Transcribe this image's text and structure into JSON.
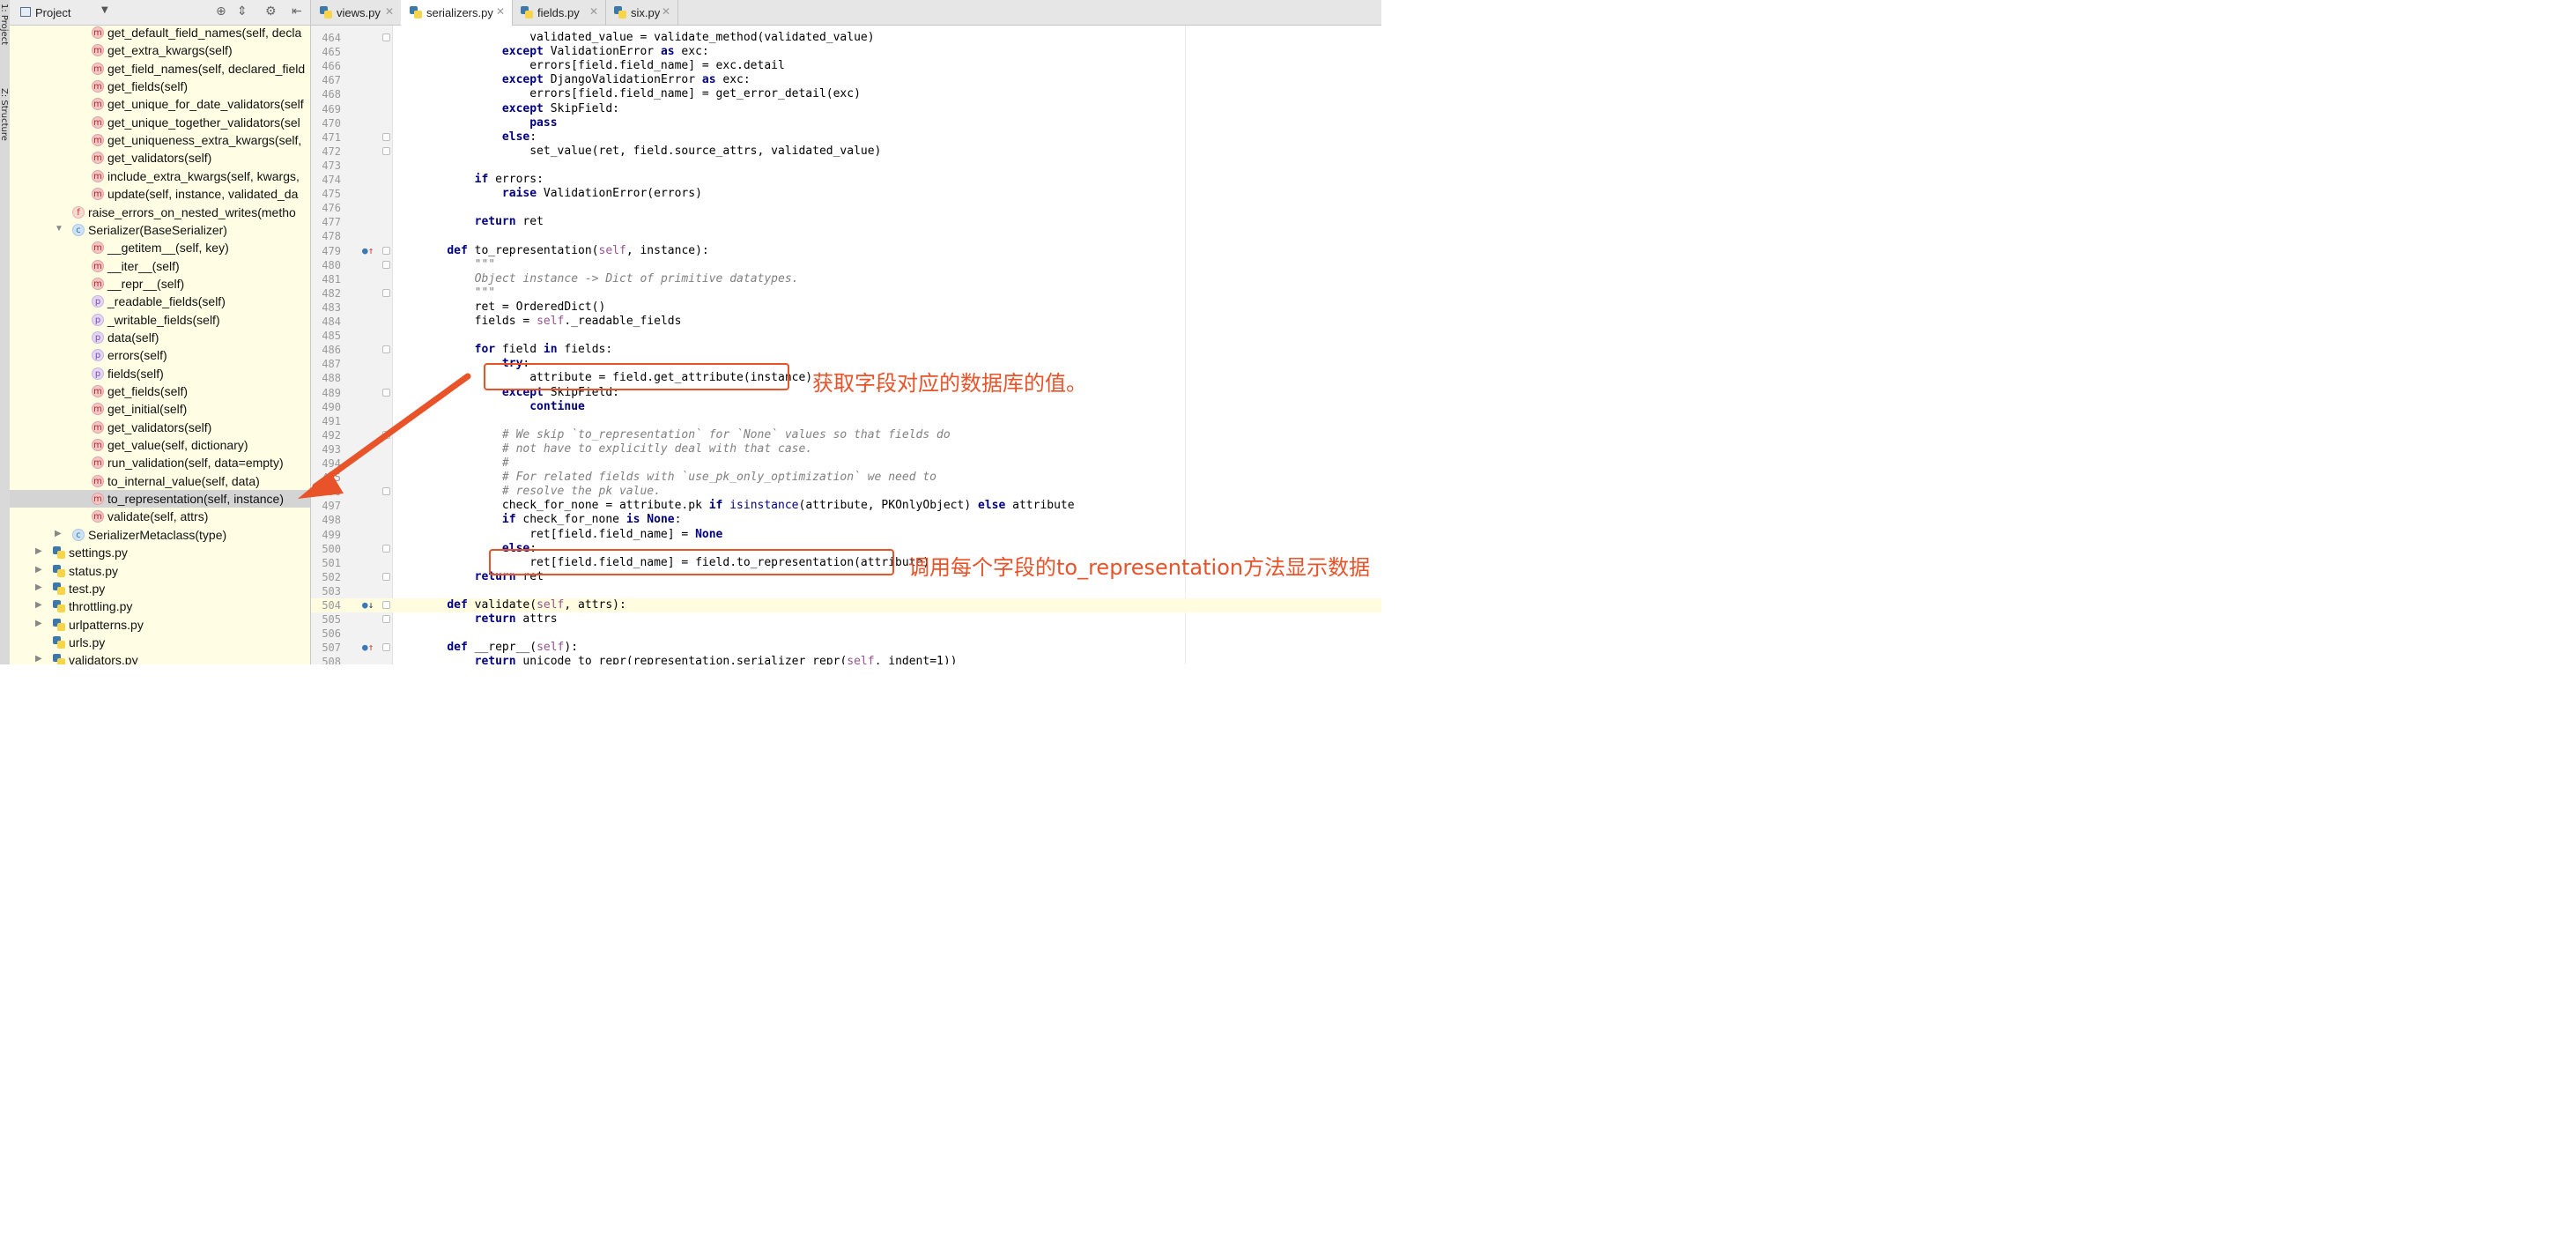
{
  "tool_strip": {
    "project_label": "1: Project",
    "structure_label": "Z: Structure"
  },
  "project_panel": {
    "title": "Project",
    "tree": [
      {
        "kind": "m",
        "label": "get_default_field_names(self, decla",
        "indent": 104
      },
      {
        "kind": "m",
        "label": "get_extra_kwargs(self)",
        "indent": 104
      },
      {
        "kind": "m",
        "label": "get_field_names(self, declared_field",
        "indent": 104
      },
      {
        "kind": "m",
        "label": "get_fields(self)",
        "indent": 104
      },
      {
        "kind": "m",
        "label": "get_unique_for_date_validators(self",
        "indent": 104
      },
      {
        "kind": "m",
        "label": "get_unique_together_validators(sel",
        "indent": 104
      },
      {
        "kind": "m",
        "label": "get_uniqueness_extra_kwargs(self,",
        "indent": 104
      },
      {
        "kind": "m",
        "label": "get_validators(self)",
        "indent": 104
      },
      {
        "kind": "m",
        "label": "include_extra_kwargs(self, kwargs,",
        "indent": 104
      },
      {
        "kind": "m",
        "label": "update(self, instance, validated_da",
        "indent": 104
      },
      {
        "kind": "f",
        "label": "raise_errors_on_nested_writes(metho",
        "indent": 82
      },
      {
        "kind": "c",
        "label": "Serializer(BaseSerializer)",
        "indent": 82,
        "arrow": "▼"
      },
      {
        "kind": "m",
        "label": "__getitem__(self, key)",
        "indent": 104
      },
      {
        "kind": "m",
        "label": "__iter__(self)",
        "indent": 104
      },
      {
        "kind": "m",
        "label": "__repr__(self)",
        "indent": 104
      },
      {
        "kind": "p",
        "label": "_readable_fields(self)",
        "indent": 104
      },
      {
        "kind": "p",
        "label": "_writable_fields(self)",
        "indent": 104
      },
      {
        "kind": "p",
        "label": "data(self)",
        "indent": 104
      },
      {
        "kind": "p",
        "label": "errors(self)",
        "indent": 104
      },
      {
        "kind": "p",
        "label": "fields(self)",
        "indent": 104
      },
      {
        "kind": "m",
        "label": "get_fields(self)",
        "indent": 104
      },
      {
        "kind": "m",
        "label": "get_initial(self)",
        "indent": 104
      },
      {
        "kind": "m",
        "label": "get_validators(self)",
        "indent": 104
      },
      {
        "kind": "m",
        "label": "get_value(self, dictionary)",
        "indent": 104
      },
      {
        "kind": "m",
        "label": "run_validation(self, data=empty)",
        "indent": 104
      },
      {
        "kind": "m",
        "label": "to_internal_value(self, data)",
        "indent": 104
      },
      {
        "kind": "m",
        "label": "to_representation(self, instance)",
        "indent": 104,
        "selected": true
      },
      {
        "kind": "m",
        "label": "validate(self, attrs)",
        "indent": 104
      },
      {
        "kind": "c",
        "label": "SerializerMetaclass(type)",
        "indent": 82,
        "arrow": "▶"
      },
      {
        "kind": "py",
        "label": "settings.py",
        "indent": 60,
        "arrow": "▶"
      },
      {
        "kind": "py",
        "label": "status.py",
        "indent": 60,
        "arrow": "▶"
      },
      {
        "kind": "py",
        "label": "test.py",
        "indent": 60,
        "arrow": "▶"
      },
      {
        "kind": "py",
        "label": "throttling.py",
        "indent": 60,
        "arrow": "▶"
      },
      {
        "kind": "py",
        "label": "urlpatterns.py",
        "indent": 60,
        "arrow": "▶"
      },
      {
        "kind": "py",
        "label": "urls.py",
        "indent": 60
      },
      {
        "kind": "py",
        "label": "validators.py",
        "indent": 60,
        "arrow": "▶"
      }
    ]
  },
  "tabs": [
    {
      "label": "views.py",
      "active": false
    },
    {
      "label": "serializers.py",
      "active": true
    },
    {
      "label": "fields.py",
      "active": false
    },
    {
      "label": "six.py",
      "active": false
    }
  ],
  "editor": {
    "lines": [
      {
        "n": "464",
        "html": "                <span>validated_value = validate_method(validated_value)</span>"
      },
      {
        "n": "465",
        "html": "            <span class=\"kw\">except</span> ValidationError <span class=\"kw\">as</span> exc:"
      },
      {
        "n": "466",
        "html": "                errors[field.field_name] = exc.detail"
      },
      {
        "n": "467",
        "html": "            <span class=\"kw\">except</span> DjangoValidationError <span class=\"kw\">as</span> exc:"
      },
      {
        "n": "468",
        "html": "                errors[field.field_name] = get_error_detail(exc)"
      },
      {
        "n": "469",
        "html": "            <span class=\"kw\">except</span> SkipField:"
      },
      {
        "n": "470",
        "html": "                <span class=\"kw\">pass</span>"
      },
      {
        "n": "471",
        "html": "            <span class=\"kw\">else</span>:"
      },
      {
        "n": "472",
        "html": "                set_value(ret, field.source_attrs, validated_value)"
      },
      {
        "n": "473",
        "html": ""
      },
      {
        "n": "474",
        "html": "        <span class=\"kw\">if</span> errors:"
      },
      {
        "n": "475",
        "html": "            <span class=\"kw\">raise</span> ValidationError(errors)"
      },
      {
        "n": "476",
        "html": ""
      },
      {
        "n": "477",
        "html": "        <span class=\"kw\">return</span> ret"
      },
      {
        "n": "478",
        "html": ""
      },
      {
        "n": "479",
        "html": "    <span class=\"kw\">def</span> to_representation(<span class=\"self\">self</span>, instance):"
      },
      {
        "n": "480",
        "html": "        <span class=\"cm\">\"\"\"</span>"
      },
      {
        "n": "481",
        "html": "        <span class=\"cm\">Object instance -&gt; Dict of primitive datatypes.</span>"
      },
      {
        "n": "482",
        "html": "        <span class=\"cm\">\"\"\"</span>"
      },
      {
        "n": "483",
        "html": "        ret = OrderedDict()"
      },
      {
        "n": "484",
        "html": "        fields = <span class=\"self\">self</span>._readable_fields"
      },
      {
        "n": "485",
        "html": ""
      },
      {
        "n": "486",
        "html": "        <span class=\"kw\">for</span> field <span class=\"kw\">in</span> fields:"
      },
      {
        "n": "487",
        "html": "            <span class=\"kw\">try</span>:"
      },
      {
        "n": "488",
        "html": "                attribute = field.get_attribute(instance)"
      },
      {
        "n": "489",
        "html": "            <span class=\"kw\">except</span> SkipField:"
      },
      {
        "n": "490",
        "html": "                <span class=\"kw\">continue</span>"
      },
      {
        "n": "491",
        "html": ""
      },
      {
        "n": "492",
        "html": "            <span class=\"cm\"># We skip `to_representation` for `None` values so that fields do</span>"
      },
      {
        "n": "493",
        "html": "            <span class=\"cm\"># not have to explicitly deal with that case.</span>"
      },
      {
        "n": "494",
        "html": "            <span class=\"cm\">#</span>"
      },
      {
        "n": "495",
        "html": "            <span class=\"cm\"># For related fields with `use_pk_only_optimization` we need to</span>"
      },
      {
        "n": "496",
        "html": "            <span class=\"cm\"># resolve the pk value.</span>"
      },
      {
        "n": "497",
        "html": "            check_for_none = attribute.pk <span class=\"kw\">if</span> <span style=\"color:#000080\">isinstance</span>(attribute, PKOnlyObject) <span class=\"kw\">else</span> attribute"
      },
      {
        "n": "498",
        "html": "            <span class=\"kw\">if</span> check_for_none <span class=\"kw\">is</span> <span class=\"kw\">None</span>:"
      },
      {
        "n": "499",
        "html": "                ret[field.field_name] = <span class=\"kw\">None</span>"
      },
      {
        "n": "500",
        "html": "            <span class=\"kw\">else</span>:"
      },
      {
        "n": "501",
        "html": "                ret[field.field_name] = field.to_representation(attribute)"
      },
      {
        "n": "502",
        "html": "        <span class=\"kw\">return</span> ret"
      },
      {
        "n": "503",
        "html": ""
      },
      {
        "n": "504",
        "html": "    <span class=\"kw\">def</span> validate(<span class=\"self\">self</span>, attrs):"
      },
      {
        "n": "505",
        "html": "        <span class=\"kw\">return</span> attrs"
      },
      {
        "n": "506",
        "html": ""
      },
      {
        "n": "507",
        "html": "    <span class=\"kw\">def</span> __repr__(<span class=\"self\">self</span>):"
      },
      {
        "n": "508",
        "html": "        <span class=\"kw\">return</span> unicode_to_repr(representation.serializer_repr(<span class=\"self\">self</span>, indent=1))"
      }
    ]
  },
  "annotations": {
    "text1": "获取字段对应的数据库的值。",
    "text2": "调用每个字段的to_representation方法显示数据",
    "color": "#e8532a"
  }
}
